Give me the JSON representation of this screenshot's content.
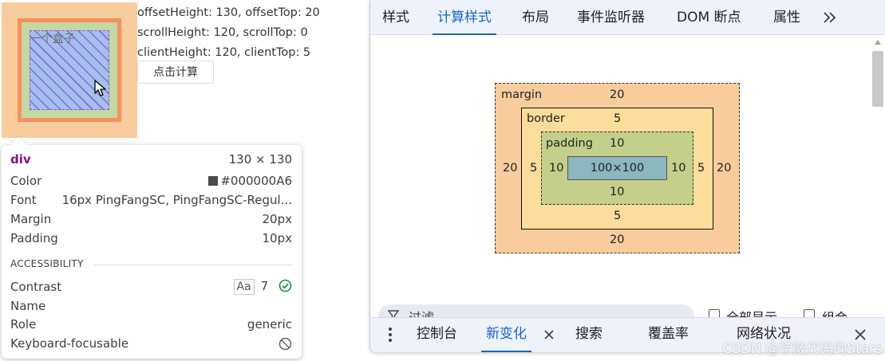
{
  "page": {
    "box_label": "一个盒子",
    "metrics": [
      "offsetHeight: 130, offsetTop: 20",
      "scrollHeight: 120, scrollTop: 0",
      "clientHeight: 120, clientTop: 5"
    ],
    "calc_button": "点击计算"
  },
  "tooltip": {
    "tag": "div",
    "size": "130 × 130",
    "rows": [
      {
        "label": "Color",
        "value": "#000000A6"
      },
      {
        "label": "Font",
        "value": "16px PingFangSC, PingFangSC-Regul..."
      },
      {
        "label": "Margin",
        "value": "20px"
      },
      {
        "label": "Padding",
        "value": "10px"
      }
    ],
    "section": "ACCESSIBILITY",
    "a11y": [
      {
        "label": "Contrast",
        "aa": "Aa",
        "value": "7"
      },
      {
        "label": "Name",
        "value": ""
      },
      {
        "label": "Role",
        "value": "generic"
      },
      {
        "label": "Keyboard-focusable",
        "value": ""
      }
    ],
    "swatch_color": "#4a4a4a"
  },
  "devtools": {
    "tabs": [
      "样式",
      "计算样式",
      "布局",
      "事件监听器",
      "DOM 断点",
      "属性"
    ],
    "active_tab": "计算样式",
    "boxmodel": {
      "margin_label": "margin",
      "border_label": "border",
      "padding_label": "padding",
      "margin": {
        "top": "20",
        "right": "20",
        "bottom": "20",
        "left": "20"
      },
      "border": {
        "top": "5",
        "right": "5",
        "bottom": "5",
        "left": "5"
      },
      "padding": {
        "top": "10",
        "right": "10",
        "bottom": "10",
        "left": "10"
      },
      "content": "100×100"
    },
    "filter": {
      "placeholder": "过滤",
      "show_all": "全部显示",
      "group": "组合"
    },
    "drawer_tabs": [
      "控制台",
      "新变化",
      "搜索",
      "覆盖率",
      "网络状况"
    ],
    "drawer_active": "新变化"
  },
  "watermark": "CSDN @学敲代码的Stars",
  "colors": {
    "accent": "#1a63c7",
    "margin": "#f9cc9d",
    "border": "#fddd9b",
    "padding": "#c3cf8a",
    "content": "#8cb6c0",
    "check": "#1e8e3e"
  }
}
